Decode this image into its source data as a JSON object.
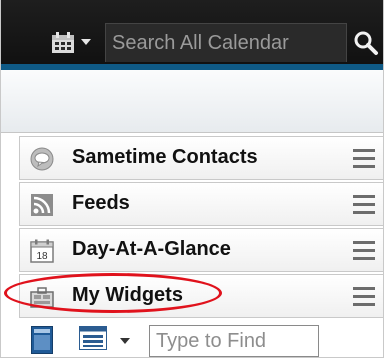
{
  "topbar": {
    "calendar_icon": "calendar-icon",
    "search_placeholder": "Search All Calendar",
    "search_icon": "search-icon"
  },
  "panels": [
    {
      "label": "Sametime Contacts",
      "icon": "chat-bubble-icon"
    },
    {
      "label": "Feeds",
      "icon": "rss-feed-icon"
    },
    {
      "label": "Day-At-A-Glance",
      "icon": "calendar-18-icon",
      "icon_text": "18"
    },
    {
      "label": "My Widgets",
      "icon": "widget-briefcase-icon"
    }
  ],
  "toolbar": {
    "find_placeholder": "Type to Find"
  },
  "colors": {
    "topbar": "#151515",
    "accent": "#0f5a86",
    "highlight_circle": "#e0121c"
  }
}
